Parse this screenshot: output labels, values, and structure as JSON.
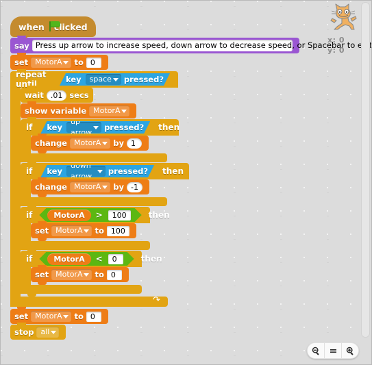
{
  "app": {
    "sprite_name": "cat-sprite",
    "x_label": "x:",
    "x_value": "0",
    "y_label": "y:",
    "y_value": "0"
  },
  "zoom_controls": {
    "zoom_out": "zoom-out",
    "zoom_reset": "=",
    "zoom_in": "zoom-in"
  },
  "script": {
    "hat": {
      "when": "when",
      "clicked": "clicked",
      "icon": "green-flag-icon"
    },
    "say": {
      "label": "say",
      "message": "Press up arrow to increase speed, down arrow to decrease speed, or Spacebar to exit."
    },
    "set_motor_init": {
      "label": "set",
      "variable": "MotorA",
      "to": "to",
      "value": "0"
    },
    "repeat_until": {
      "label": "repeat until",
      "key_label": "key",
      "key": "space",
      "pressed": "pressed?"
    },
    "wait": {
      "label": "wait",
      "value": ".01",
      "secs": "secs"
    },
    "show_variable": {
      "label": "show variable",
      "variable": "MotorA"
    },
    "if_up": {
      "if": "if",
      "key_label": "key",
      "key": "up arrow",
      "pressed": "pressed?",
      "then": "then",
      "body": {
        "label": "change",
        "variable": "MotorA",
        "by": "by",
        "value": "1"
      }
    },
    "if_down": {
      "if": "if",
      "key_label": "key",
      "key": "down arrow",
      "pressed": "pressed?",
      "then": "then",
      "body": {
        "label": "change",
        "variable": "MotorA",
        "by": "by",
        "value": "-1"
      }
    },
    "if_gt": {
      "if": "if",
      "variable": "MotorA",
      "operator": ">",
      "compare_value": "100",
      "then": "then",
      "body": {
        "label": "set",
        "variable": "MotorA",
        "to": "to",
        "value": "100"
      }
    },
    "if_lt": {
      "if": "if",
      "variable": "MotorA",
      "operator": "<",
      "compare_value": "0",
      "then": "then",
      "body": {
        "label": "set",
        "variable": "MotorA",
        "to": "to",
        "value": "0"
      }
    },
    "set_motor_final": {
      "label": "set",
      "variable": "MotorA",
      "to": "to",
      "value": "0"
    },
    "stop": {
      "label": "stop",
      "target": "all"
    }
  },
  "colors": {
    "control": "#e2a413",
    "data": "#ee7d16",
    "looks": "#9a56d2",
    "sensing": "#2ca5e2",
    "operators": "#5cb712",
    "events": "#c48b2e",
    "background": "#dcdcdc"
  }
}
